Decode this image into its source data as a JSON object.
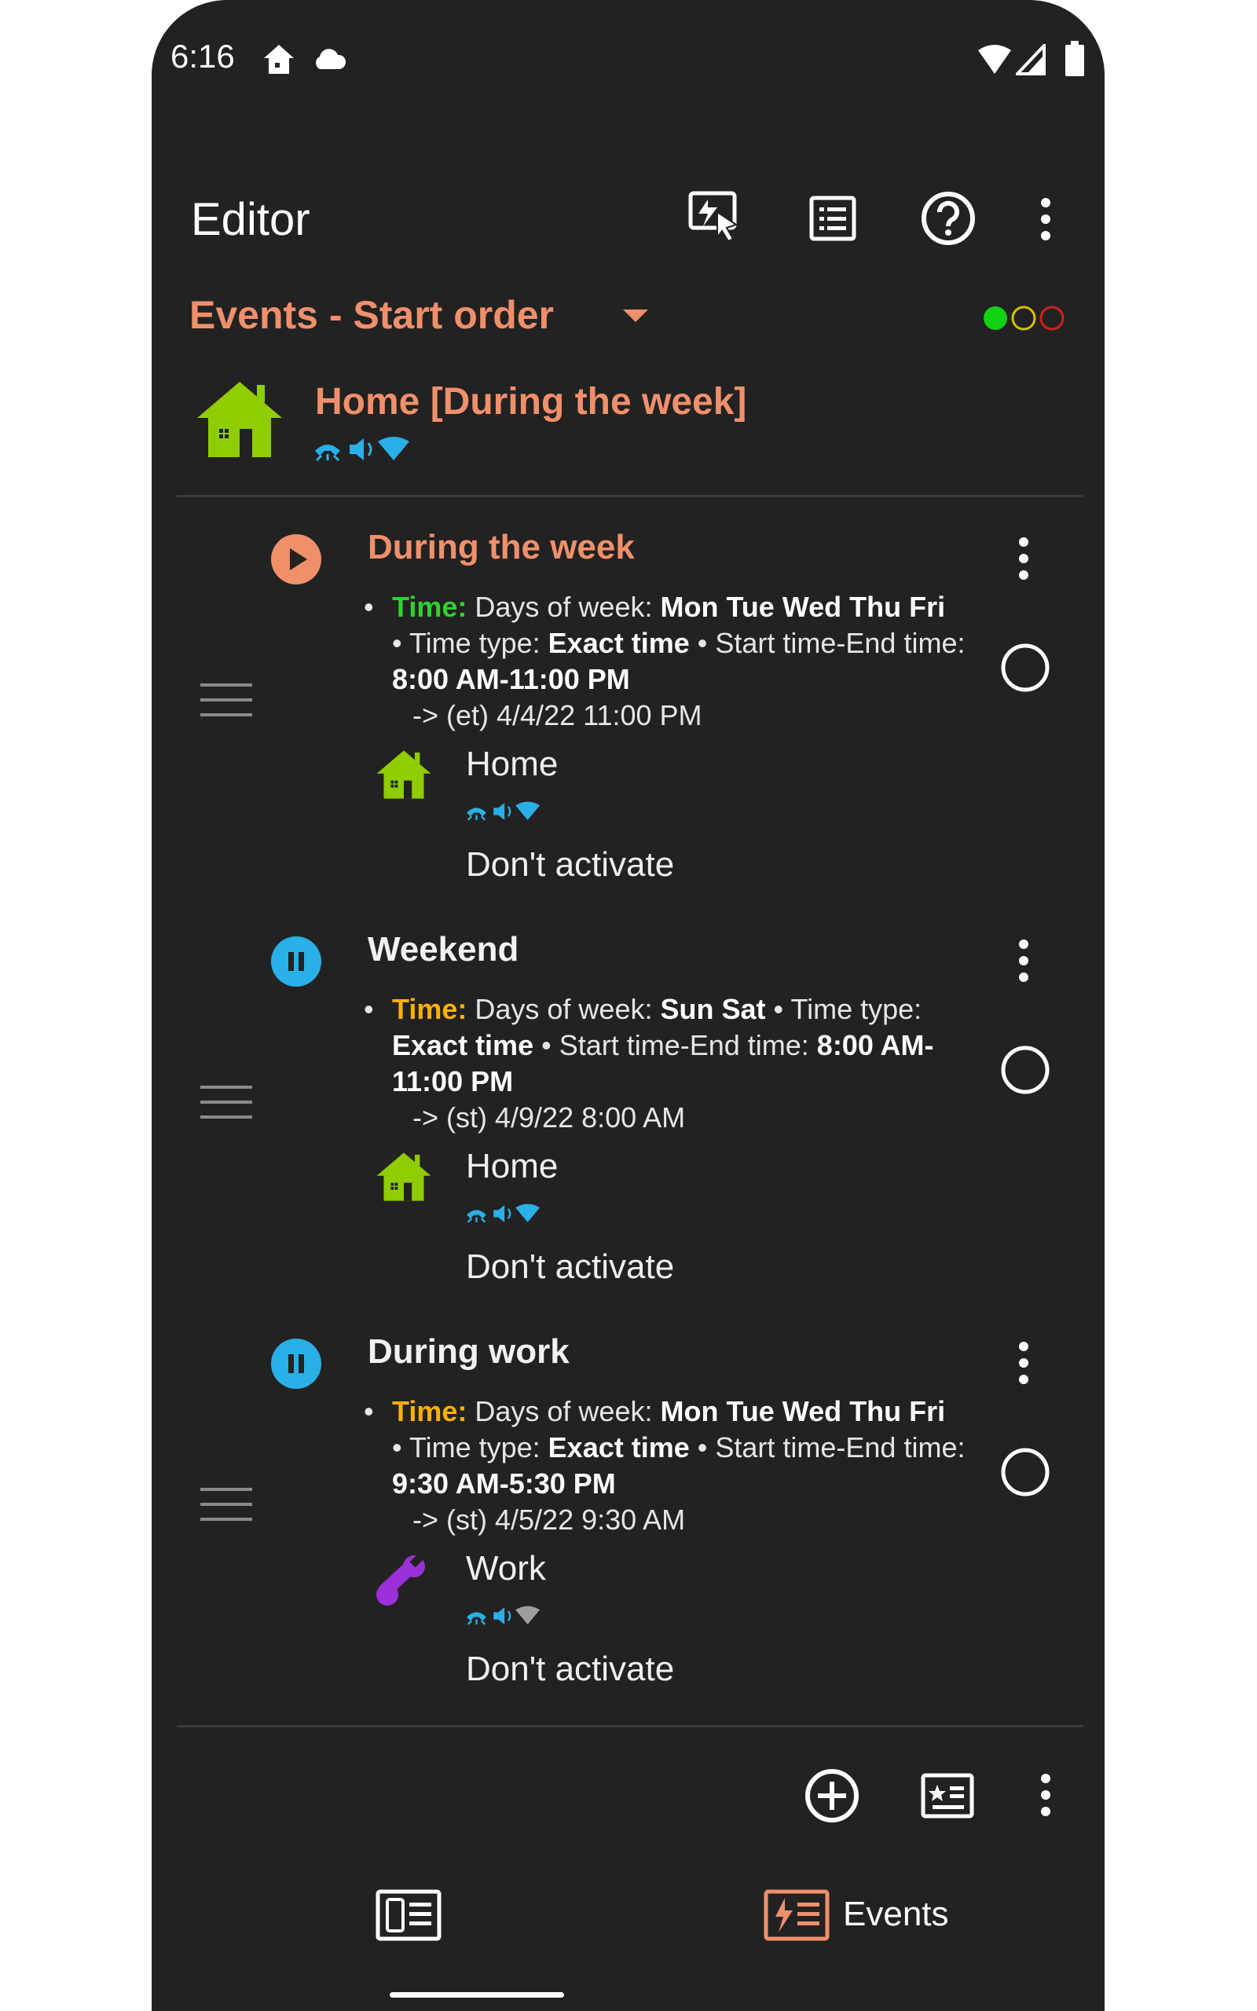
{
  "status_bar": {
    "time": "6:16"
  },
  "toolbar": {
    "title": "Editor"
  },
  "filter": {
    "label": "Events - Start order"
  },
  "colors": {
    "accent": "#f0906a",
    "home_green": "#8fcc00",
    "work_purple": "#9b30d9",
    "running": "#f0906a",
    "paused": "#29b0e8",
    "wifi_on": "#29b0e8",
    "wifi_off": "#9e9e9e"
  },
  "active_profile": {
    "name": "Home [During the week]",
    "icon": "house-icon"
  },
  "events": [
    {
      "name": "During the week",
      "state": "running",
      "time_label": "Time:",
      "desc1": " Days of week: ",
      "days": "Mon Tue Wed Thu Fri",
      "desc2": " • Time type: ",
      "type": "Exact time",
      "desc3": " • Start time-End time: ",
      "range": "8:00 AM-11:00 PM",
      "next": "-> (et) 4/4/22 11:00 PM",
      "profile": "Home",
      "profile_icon": "house-icon",
      "action": "Don't activate"
    },
    {
      "name": "Weekend",
      "state": "paused",
      "time_label": "Time:",
      "desc1": " Days of week: ",
      "days": "Sun Sat",
      "desc2": " • Time type: ",
      "type": "Exact time",
      "desc3": " • Start time-End time: ",
      "range": "8:00 AM-11:00 PM",
      "next": "-> (st) 4/9/22 8:00 AM",
      "profile": "Home",
      "profile_icon": "house-icon",
      "action": "Don't activate"
    },
    {
      "name": "During work",
      "state": "paused",
      "time_label": "Time:",
      "desc1": " Days of week: ",
      "days": "Mon Tue Wed Thu Fri",
      "desc2": " • Time type: ",
      "type": "Exact time",
      "desc3": " • Start time-End time: ",
      "range": "9:30 AM-5:30 PM",
      "next": "-> (st) 4/5/22 9:30 AM",
      "profile": "Work",
      "profile_icon": "wrench-icon",
      "action": "Don't activate"
    }
  ],
  "bottom_nav": {
    "events_label": "Events"
  }
}
